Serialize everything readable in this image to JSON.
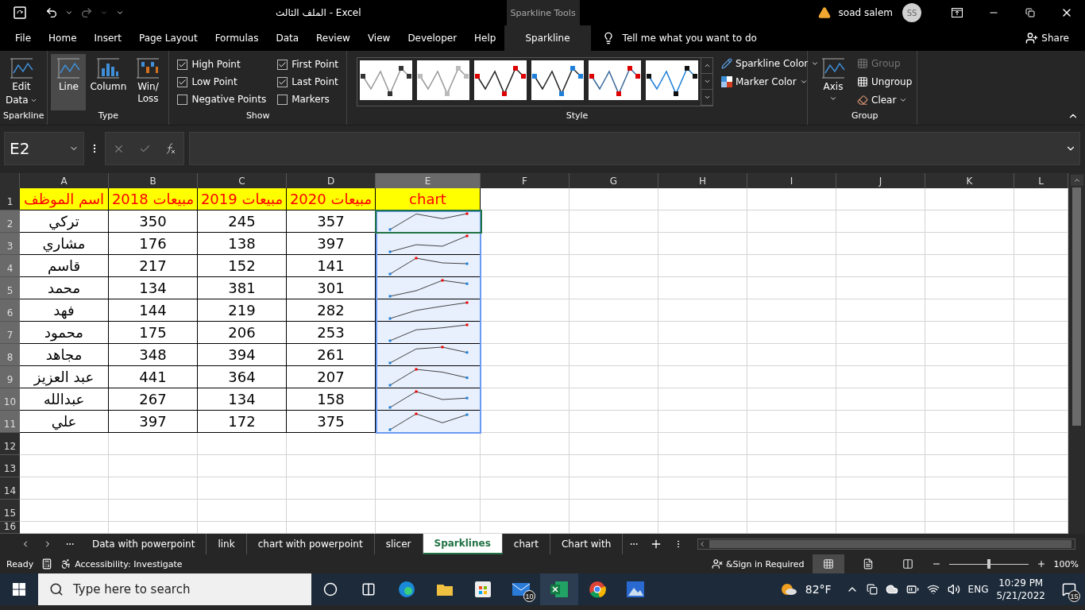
{
  "title_bar": {
    "title": "الملف الثالث  -  Excel",
    "context_tab": "Sparkline Tools",
    "user": "soad salem",
    "avatar": "SS"
  },
  "menu_tabs": [
    {
      "label": "File",
      "selected": false
    },
    {
      "label": "Home",
      "selected": false
    },
    {
      "label": "Insert",
      "selected": false
    },
    {
      "label": "Page Layout",
      "selected": false
    },
    {
      "label": "Formulas",
      "selected": false
    },
    {
      "label": "Data",
      "selected": false
    },
    {
      "label": "Review",
      "selected": false
    },
    {
      "label": "View",
      "selected": false
    },
    {
      "label": "Developer",
      "selected": false
    },
    {
      "label": "Help",
      "selected": false
    },
    {
      "label": "Sparkline",
      "selected": true
    }
  ],
  "tell_me": "Tell me what you want to do",
  "share": "Share",
  "ribbon": {
    "sparkline_group": {
      "label": "Sparkline",
      "edit_data": [
        "Edit",
        "Data"
      ]
    },
    "type_group": {
      "label": "Type",
      "buttons": [
        {
          "label": "Line",
          "selected": true
        },
        {
          "label": "Column",
          "selected": false
        },
        {
          "label": "Win/\nLoss",
          "selected": false
        }
      ]
    },
    "show_group": {
      "label": "Show",
      "checkboxes": [
        {
          "label": "High Point",
          "checked": true
        },
        {
          "label": "Low Point",
          "checked": true
        },
        {
          "label": "Negative Points",
          "checked": false
        },
        {
          "label": "First Point",
          "checked": true
        },
        {
          "label": "Last Point",
          "checked": true
        },
        {
          "label": "Markers",
          "checked": false
        }
      ]
    },
    "style_group": {
      "label": "Style",
      "sparkline_color": "Sparkline Color",
      "marker_color": "Marker Color"
    },
    "group_group": {
      "label": "Group",
      "axis": "Axis",
      "buttons": [
        {
          "label": "Group",
          "disabled": true
        },
        {
          "label": "Ungroup",
          "disabled": false
        },
        {
          "label": "Clear",
          "disabled": false
        }
      ]
    }
  },
  "formula_bar": {
    "name_box": "E2"
  },
  "sheet": {
    "columns": [
      {
        "label": "A",
        "selected": false
      },
      {
        "label": "B",
        "selected": false
      },
      {
        "label": "C",
        "selected": false
      },
      {
        "label": "D",
        "selected": false
      },
      {
        "label": "E",
        "selected": true
      },
      {
        "label": "F",
        "selected": false
      },
      {
        "label": "G",
        "selected": false
      },
      {
        "label": "H",
        "selected": false
      },
      {
        "label": "I",
        "selected": false
      },
      {
        "label": "J",
        "selected": false
      },
      {
        "label": "K",
        "selected": false
      },
      {
        "label": "L",
        "selected": false
      }
    ],
    "header": {
      "column_a": "اسم الموظف",
      "column_b": "مبيعات 2018",
      "column_c": "مبيعات 2019",
      "column_d": "مبيعات 2020",
      "column_e": "chart"
    },
    "rows": [
      {
        "name": "تركي",
        "values": [
          "350",
          "245",
          "357"
        ]
      },
      {
        "name": "مشاري",
        "values": [
          "176",
          "138",
          "397"
        ]
      },
      {
        "name": "قاسم",
        "values": [
          "217",
          "152",
          "141"
        ]
      },
      {
        "name": "محمد",
        "values": [
          "134",
          "381",
          "301"
        ]
      },
      {
        "name": "فهد",
        "values": [
          "144",
          "219",
          "282"
        ]
      },
      {
        "name": "محمود",
        "values": [
          "175",
          "206",
          "253"
        ]
      },
      {
        "name": "مجاهد",
        "values": [
          "348",
          "394",
          "261"
        ]
      },
      {
        "name": "عبد العزيز",
        "values": [
          "441",
          "364",
          "207"
        ]
      },
      {
        "name": "عبدالله",
        "values": [
          "267",
          "134",
          "158"
        ]
      },
      {
        "name": "علي",
        "values": [
          "397",
          "172",
          "375"
        ]
      }
    ],
    "row_numbers": [
      "1",
      "2",
      "3",
      "4",
      "5",
      "6",
      "7",
      "8",
      "9",
      "10",
      "11",
      "12",
      "13",
      "14",
      "15",
      "16"
    ]
  },
  "sheet_tabs": [
    {
      "label": "Data with powerpoint",
      "selected": false
    },
    {
      "label": "link",
      "selected": false
    },
    {
      "label": "chart with powerpoint",
      "selected": false
    },
    {
      "label": "slicer",
      "selected": false
    },
    {
      "label": "Sparklines",
      "selected": true
    },
    {
      "label": "chart",
      "selected": false
    },
    {
      "label": "Chart with",
      "selected": false
    }
  ],
  "status_bar": {
    "mode": "Ready",
    "accessibility": "Accessibility: Investigate",
    "sign_in": "&Sign in Required",
    "zoom": {
      "level": 0.5
    },
    "zoom_text": "100%"
  },
  "taskbar": {
    "search_placeholder": "Type here to search",
    "mail_badge": "10",
    "temperature": "82°F",
    "language": "ENG",
    "time": "10:29 PM",
    "date": "5/21/2022",
    "notifications": "15"
  }
}
